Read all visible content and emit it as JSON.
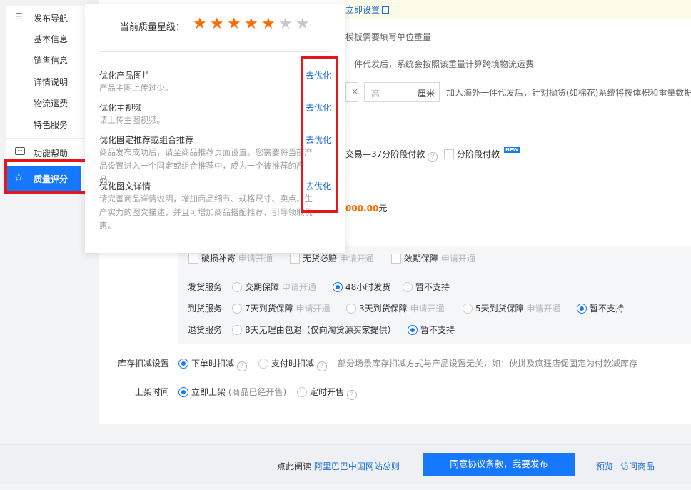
{
  "notice": {
    "link_text": "立即设置"
  },
  "form": {
    "weight_hint": "模板需要填写单位重量",
    "weight_desc": "一件代发后，系统会按照该重量计算跨境物流运费",
    "height_placeholder": "高",
    "size_unit": "厘米",
    "size_desc": "加入海外一件代发后，针对抛货(如棉花)系统将按体积和重量数据",
    "installment_label": "交易—37分阶段付款",
    "installment_checkbox": "分阶段付款",
    "new_badge": "NEW",
    "price_amount": "000.00",
    "price_unit": "元",
    "services_top": [
      {
        "label": "破损补寄",
        "hint": "申请开通"
      },
      {
        "label": "无货必赔",
        "hint": "申请开通"
      },
      {
        "label": "效期保障",
        "hint": "申请开通"
      }
    ],
    "ship_label": "发货服务",
    "ship_opts": [
      {
        "label": "交期保障",
        "hint": "申请开通",
        "selected": false
      },
      {
        "label": "48小时发货",
        "hint": "",
        "selected": true
      },
      {
        "label": "暂不支持",
        "hint": "",
        "selected": false
      }
    ],
    "arrive_label": "到货服务",
    "arrive_opts": [
      {
        "label": "7天到货保障",
        "hint": "申请开通",
        "selected": false
      },
      {
        "label": "3天到货保障",
        "hint": "申请开通",
        "selected": false
      },
      {
        "label": "5天到货保障",
        "hint": "申请开通",
        "selected": false
      },
      {
        "label": "暂不支持",
        "hint": "",
        "selected": true
      }
    ],
    "return_label": "退货服务",
    "return_opts": [
      {
        "label": "8天无理由包退（仅向淘货源买家提供）",
        "selected": false
      },
      {
        "label": "暂不支持",
        "selected": true
      }
    ],
    "stock_label": "库存扣减设置",
    "stock_opts": [
      {
        "label": "下单时扣减",
        "selected": true
      },
      {
        "label": "支付时扣减",
        "selected": false
      }
    ],
    "stock_desc": "部分场景库存扣减方式与产品设置无关，如：伙拼及疯狂店促固定为付款减库存",
    "shelf_label": "上架时间",
    "shelf_opt1": "立即上架",
    "shelf_opt1_note": "(商品已经开售)",
    "shelf_opt2": "定时开售"
  },
  "sidebar": {
    "nav_title": "发布导航",
    "items": [
      "基本信息",
      "销售信息",
      "详情说明",
      "物流运费",
      "特色服务"
    ],
    "help": "功能帮助",
    "quality": "质量评分"
  },
  "popup": {
    "rating_label": "当前质量星级：",
    "stars_filled": 5,
    "stars_total": 7,
    "tips": [
      {
        "title": "优化产品图片",
        "desc": "产品主图上传过少。",
        "action": "去优化"
      },
      {
        "title": "优化主视频",
        "desc": "请上传主图视频。",
        "action": "去优化"
      },
      {
        "title": "优化固定推荐或组合推荐",
        "desc": "商品发布成功后，请至商品推荐页面设置。您需要将当前产品设置进入一个固定或组合推荐中，成为一个被推荐的产品。",
        "action": "去优化"
      },
      {
        "title": "优化图文详情",
        "desc": "请完善商品详情说明，增加商品细节、规格尺寸、卖点、生产实力的图文描述，并且可增加商品搭配推荐、引导领取优惠。",
        "action": "去优化"
      }
    ]
  },
  "footer": {
    "read_prefix": "点此阅读",
    "rules_link": "阿里巴巴中国网站总则",
    "publish_button": "同意协议条款，我要发布",
    "preview": "预览",
    "visit": "访问商品"
  },
  "colors": {
    "accent": "#1677ff",
    "star": "#ff6a00",
    "highlight": "#e8161b"
  }
}
